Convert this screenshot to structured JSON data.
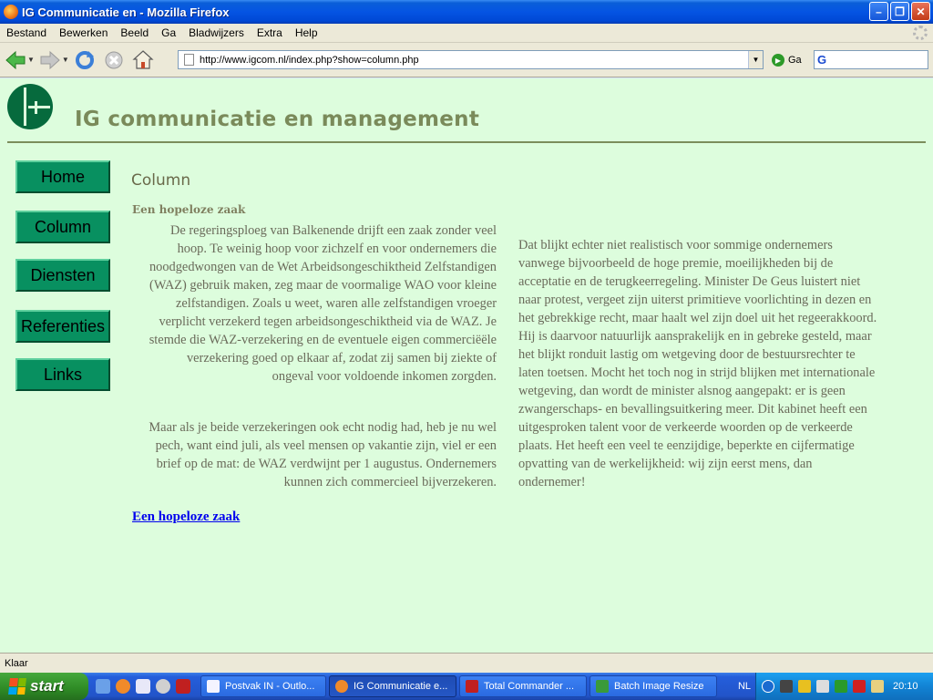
{
  "window": {
    "title": "IG Communicatie en - Mozilla Firefox"
  },
  "menubar": {
    "items": [
      "Bestand",
      "Bewerken",
      "Beeld",
      "Ga",
      "Bladwijzers",
      "Extra",
      "Help"
    ]
  },
  "toolbar": {
    "url": "http://www.igcom.nl/index.php?show=column.php",
    "go_label": "Ga",
    "search_engine": "G"
  },
  "page": {
    "site_title": "IG communicatie en management",
    "nav": [
      "Home",
      "Column",
      "Diensten",
      "Referenties",
      "Links"
    ],
    "section_heading": "Column",
    "article_title": "Een hopeloze zaak",
    "paragraph1": "De regeringsploeg van Balkenende drijft een zaak zonder veel hoop. Te weinig hoop voor zichzelf en voor ondernemers die noodgedwongen van de Wet Arbeidsongeschiktheid Zelfstandigen (WAZ) gebruik maken, zeg maar de voormalige WAO voor kleine zelfstandigen. Zoals u weet, waren alle zelfstandigen vroeger verplicht verzekerd tegen arbeidsongeschiktheid via de WAZ. Je stemde die WAZ-verzekering en de eventuele eigen commerciëële verzekering goed op elkaar af, zodat zij samen bij ziekte of ongeval voor voldoende inkomen zorgden.",
    "paragraph2": "Maar als je beide verzekeringen ook echt nodig had, heb je nu wel pech, want eind juli, als veel mensen op vakantie zijn, viel er een brief op de mat: de WAZ verdwijnt per 1 augustus. Ondernemers kunnen zich commercieel bijverzekeren.",
    "paragraph3": "Dat blijkt echter niet realistisch voor sommige ondernemers vanwege bijvoorbeeld de hoge premie, moeilijkheden bij de acceptatie en de terugkeerregeling. Minister De Geus luistert niet naar protest, vergeet zijn uiterst primitieve voorlichting in dezen en het gebrekkige recht, maar haalt wel zijn doel uit het regeerakkoord. Hij is daarvoor natuurlijk aansprakelijk en in gebreke gesteld, maar het blijkt ronduit lastig om wetgeving door de bestuursrechter te laten toetsen. Mocht het toch nog in strijd blijken met internationale wetgeving, dan wordt de minister alsnog aangepakt: er is geen zwangerschaps- en bevallingsuitkering meer. Dit kabinet heeft een uitgesproken talent voor de verkeerde woorden op de verkeerde plaats. Het heeft een veel te eenzijdige, beperkte en cijfermatige opvatting van de werkelijkheid: wij zijn eerst mens, dan ondernemer!",
    "article_link": "Een hopeloze zaak"
  },
  "statusbar": {
    "text": "Klaar"
  },
  "taskbar": {
    "start_label": "start",
    "tasks": [
      {
        "label": "Postvak IN - Outlo...",
        "active": false
      },
      {
        "label": "IG Communicatie e...",
        "active": true
      },
      {
        "label": "Total Commander ...",
        "active": false
      },
      {
        "label": "Batch Image Resize",
        "active": false
      }
    ],
    "language": "NL",
    "clock": "20:10"
  },
  "colors": {
    "page_background": "#ddfddd",
    "nav_button": "#089060",
    "site_title": "#7a8a5a",
    "body_text": "#6a6a5a",
    "link": "#0000ee"
  }
}
